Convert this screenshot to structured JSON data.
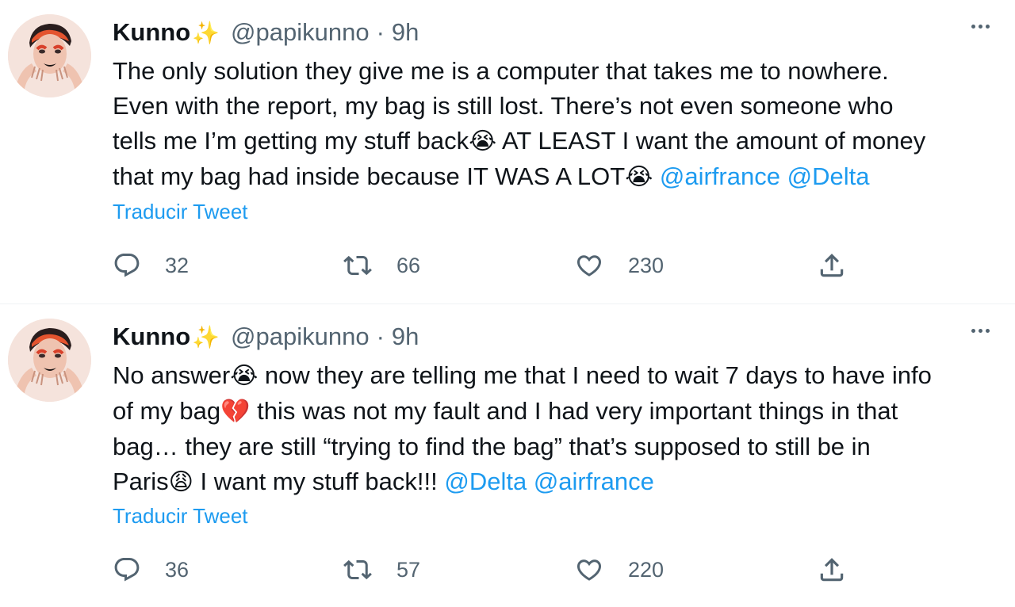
{
  "colors": {
    "accent": "#1d9bf0",
    "secondary_text": "#536471",
    "primary_text": "#0f1419",
    "divider": "#eff3f4"
  },
  "icons": {
    "reply": "reply-icon",
    "retweet": "retweet-icon",
    "like": "heart-icon",
    "share": "share-icon",
    "more": "more-icon"
  },
  "tweets": [
    {
      "name": "Kunno",
      "name_emoji": "✨",
      "handle": "@papikunno",
      "separator": "·",
      "time": "9h",
      "lines": [
        {
          "text": "The only solution they give me is a computer that takes me to nowhere."
        },
        {
          "text": "Even with the report, my bag is still lost. There’s not even someone who"
        },
        {
          "text": "tells me I’m getting my stuff back",
          "emoji": "😭",
          "text_after": " AT LEAST I want the amount of money"
        },
        {
          "text": "that my bag had inside because IT WAS A LOT",
          "emoji": "😭",
          "mention1": "@airfrance",
          "mention2": "@Delta"
        }
      ],
      "translate_label": "Traducir Tweet",
      "reply_count": "32",
      "retweet_count": "66",
      "like_count": "230"
    },
    {
      "name": "Kunno",
      "name_emoji": "✨",
      "handle": "@papikunno",
      "separator": "·",
      "time": "9h",
      "lines": [
        {
          "text": "No answer",
          "emoji": "😭",
          "text_after": " now they are telling me that I need to wait 7 days to have info"
        },
        {
          "text": "of my bag",
          "emoji": "💔",
          "text_after": " this was not my fault and I had very important things in that"
        },
        {
          "text": "bag… they are still “trying to find the bag” that’s supposed to still be in"
        },
        {
          "text": "Paris",
          "emoji": "😩",
          "text_after": " I want my stuff back!!! ",
          "mention1": "@Delta",
          "mention2": "@airfrance"
        }
      ],
      "translate_label": "Traducir Tweet",
      "reply_count": "36",
      "retweet_count": "57",
      "like_count": "220"
    }
  ]
}
